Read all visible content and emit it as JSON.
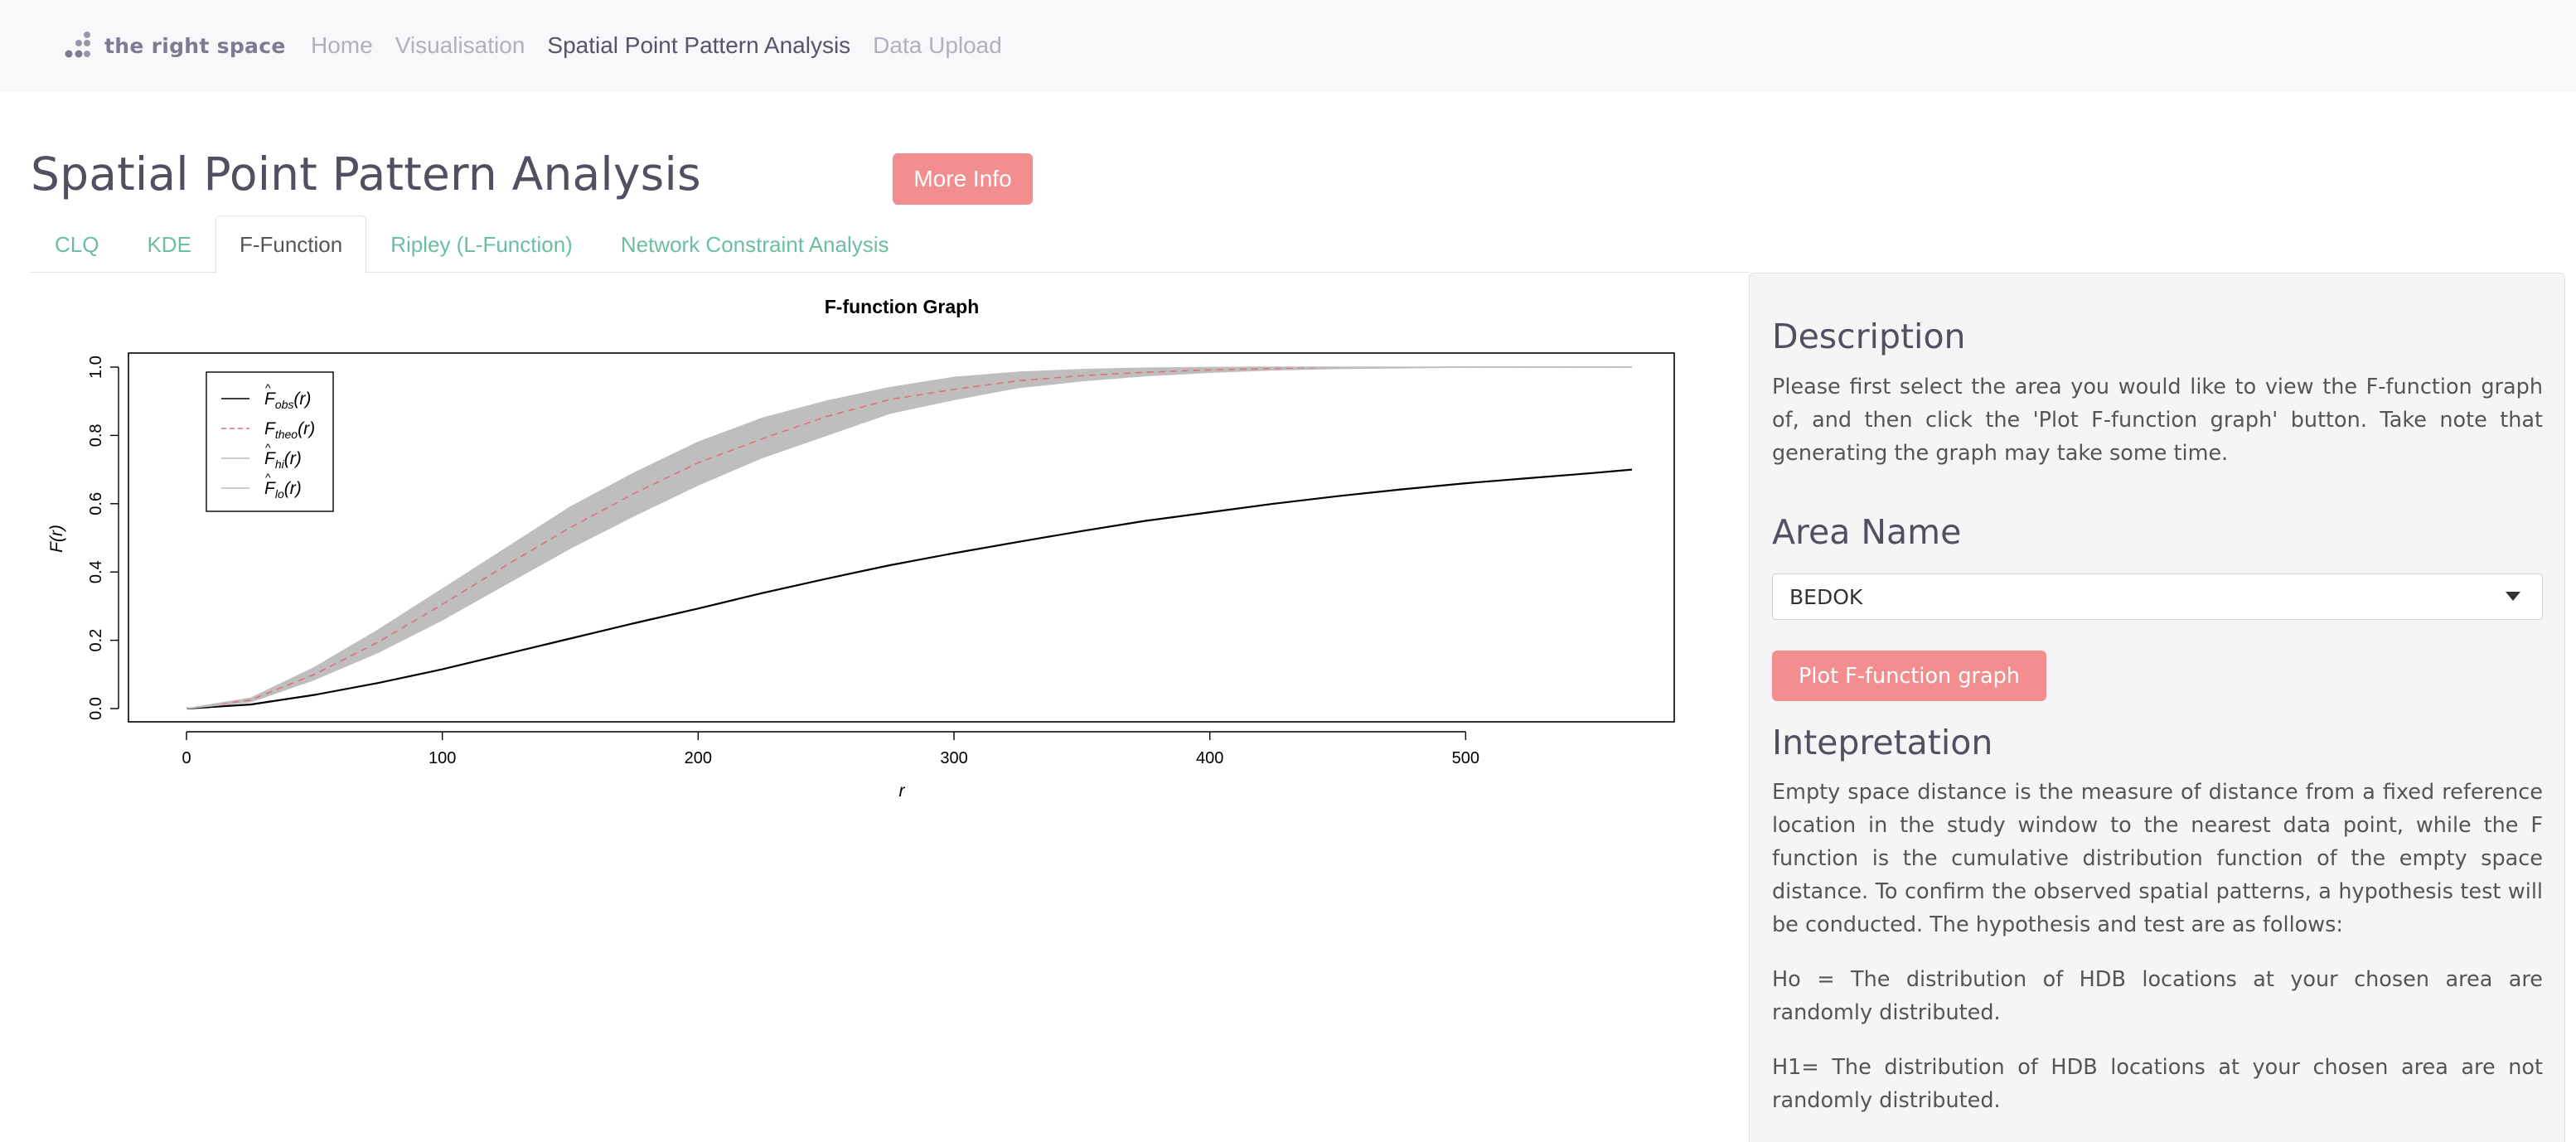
{
  "brand": {
    "name": "the right space"
  },
  "nav": {
    "items": [
      {
        "label": "Home",
        "active": false
      },
      {
        "label": "Visualisation",
        "active": false
      },
      {
        "label": "Spatial Point Pattern Analysis",
        "active": true
      },
      {
        "label": "Data Upload",
        "active": false
      }
    ]
  },
  "page": {
    "title": "Spatial Point Pattern Analysis",
    "more_info_label": "More Info"
  },
  "tabs": [
    {
      "label": "CLQ",
      "active": false
    },
    {
      "label": "KDE",
      "active": false
    },
    {
      "label": "F-Function",
      "active": true
    },
    {
      "label": "Ripley (L-Function)",
      "active": false
    },
    {
      "label": "Network Constraint Analysis",
      "active": false
    }
  ],
  "chart_data": {
    "type": "line",
    "title": "F-function Graph",
    "xlabel": "r",
    "ylabel": "F(r)",
    "xlim": [
      0,
      565
    ],
    "ylim": [
      0,
      1
    ],
    "xticks": [
      0,
      100,
      200,
      300,
      400,
      500
    ],
    "yticks": [
      "0.0",
      "0.2",
      "0.4",
      "0.6",
      "0.8",
      "1.0"
    ],
    "legend_position": "top-left",
    "x": [
      0,
      25,
      50,
      75,
      100,
      125,
      150,
      175,
      200,
      225,
      250,
      275,
      300,
      325,
      350,
      375,
      400,
      425,
      450,
      475,
      500,
      525,
      550,
      565
    ],
    "series": [
      {
        "key": "obs",
        "legend_main": "F",
        "legend_sub": "obs",
        "legend_suffix": "(r)",
        "hat": true,
        "color": "#000000",
        "style": "solid",
        "values": [
          0,
          0.012,
          0.04,
          0.075,
          0.115,
          0.16,
          0.205,
          0.25,
          0.293,
          0.338,
          0.38,
          0.42,
          0.455,
          0.488,
          0.52,
          0.55,
          0.575,
          0.6,
          0.622,
          0.642,
          0.66,
          0.675,
          0.69,
          0.7
        ]
      },
      {
        "key": "theo",
        "legend_main": "F",
        "legend_sub": "theo",
        "legend_suffix": "(r)",
        "hat": false,
        "color": "#e0707a",
        "style": "dashed",
        "values": [
          0,
          0.025,
          0.1,
          0.195,
          0.305,
          0.42,
          0.53,
          0.63,
          0.72,
          0.79,
          0.855,
          0.905,
          0.935,
          0.96,
          0.975,
          0.985,
          0.992,
          0.996,
          0.998,
          0.999,
          1.0,
          1.0,
          1.0,
          1.0
        ]
      },
      {
        "key": "hi",
        "legend_main": "F",
        "legend_sub": "hi",
        "legend_suffix": "(r)",
        "hat": true,
        "color": "#bebebe",
        "style": "solid",
        "values": [
          0,
          0.03,
          0.12,
          0.23,
          0.35,
          0.47,
          0.59,
          0.69,
          0.78,
          0.85,
          0.9,
          0.94,
          0.97,
          0.985,
          0.993,
          0.997,
          0.999,
          1.0,
          1.0,
          1.0,
          1.0,
          1.0,
          1.0,
          1.0
        ]
      },
      {
        "key": "lo",
        "legend_main": "F",
        "legend_sub": "lo",
        "legend_suffix": "(r)",
        "hat": true,
        "color": "#bebebe",
        "style": "solid",
        "values": [
          0,
          0.02,
          0.085,
          0.165,
          0.26,
          0.365,
          0.47,
          0.565,
          0.655,
          0.735,
          0.8,
          0.865,
          0.905,
          0.94,
          0.96,
          0.975,
          0.985,
          0.992,
          0.996,
          0.998,
          1.0,
          1.0,
          1.0,
          1.0
        ]
      }
    ]
  },
  "sidebar": {
    "description_heading": "Description",
    "description_text": "Please first select the area you would like to view the F-function graph of, and then click the 'Plot F-function graph' button. Take note that generating the graph may take some time.",
    "area_heading": "Area Name",
    "area_selected": "BEDOK",
    "plot_button_label": "Plot F-function graph",
    "interpretation_heading": "Intepretation",
    "interpretation_text": "Empty space distance is the measure of distance from a fixed reference location in the study window to the nearest data point, while the F function is the cumulative distribution function of the empty space distance. To confirm the observed spatial patterns, a hypothesis test will be conducted. The hypothesis and test are as follows:",
    "h0_text": "Ho = The distribution of HDB locations at your chosen area are randomly distributed.",
    "h1_text": "H1= The distribution of HDB locations at your chosen area are not randomly distributed."
  },
  "colors": {
    "accent_button": "#f28e8f",
    "tab_link": "#6cbf9d",
    "navbar_bg": "#f8f8fa",
    "envelope_fill": "#bebebe"
  },
  "icons": {
    "brand": "dots-logo-icon",
    "dropdown": "caret-down-icon"
  }
}
